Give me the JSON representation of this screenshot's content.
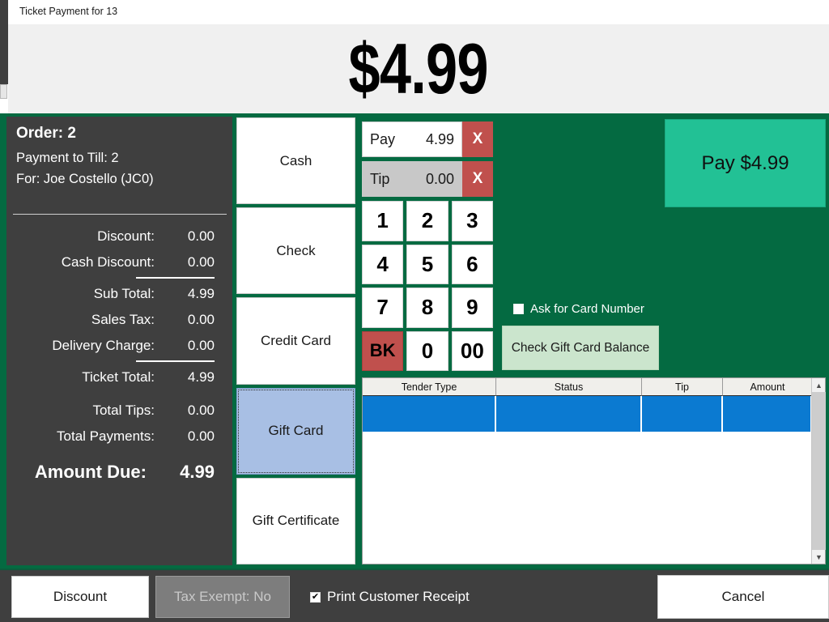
{
  "window": {
    "title": "Ticket Payment for 13"
  },
  "header": {
    "amount_display": "$4.99"
  },
  "colors": {
    "green_panel": "#046A41",
    "dark_sidebar": "#3f3f3f",
    "pay_button_teal": "#22c195",
    "delete_red": "#c0504d",
    "selected_tender_blue": "#a8bfe4",
    "grid_row_blue": "#0b7ad1",
    "gift_balance_green": "#cbe5cd"
  },
  "sidebar": {
    "order_label": "Order: 2",
    "payment_to_till": "Payment to Till: 2",
    "for_customer": "For: Joe Costello (JC0)",
    "rows": [
      {
        "label": "Discount:",
        "value": "0.00"
      },
      {
        "label": "Cash Discount:",
        "value": "0.00"
      },
      {
        "label": "Sub Total:",
        "value": "4.99"
      },
      {
        "label": "Sales Tax:",
        "value": "0.00"
      },
      {
        "label": "Delivery Charge:",
        "value": "0.00"
      },
      {
        "label": "Ticket Total:",
        "value": "4.99"
      },
      {
        "label": "Total Tips:",
        "value": "0.00"
      },
      {
        "label": "Total Payments:",
        "value": "0.00"
      }
    ],
    "amount_due_label": "Amount Due:",
    "amount_due_value": "4.99"
  },
  "tenders": {
    "items": [
      {
        "label": "Cash",
        "selected": false
      },
      {
        "label": "Check",
        "selected": false
      },
      {
        "label": "Credit Card",
        "selected": false
      },
      {
        "label": "Gift Card",
        "selected": true
      },
      {
        "label": "Gift Certificate",
        "selected": false
      }
    ]
  },
  "entry": {
    "pay_label": "Pay",
    "pay_value": "4.99",
    "pay_clear": "X",
    "tip_label": "Tip",
    "tip_value": "0.00",
    "tip_clear": "X",
    "keys": [
      "1",
      "2",
      "3",
      "4",
      "5",
      "6",
      "7",
      "8",
      "9",
      "BK",
      "0",
      "00"
    ]
  },
  "actions": {
    "pay_button": "Pay $4.99",
    "ask_card_number_label": "Ask for Card Number",
    "ask_card_number_checked": false,
    "check_gift_balance": "Check Gift Card Balance"
  },
  "table": {
    "columns": [
      "Tender Type",
      "Status",
      "Tip",
      "Amount"
    ],
    "rows": [
      {
        "tender_type": "",
        "status": "",
        "tip": "",
        "amount": ""
      }
    ],
    "scroll_up_icon": "▲",
    "scroll_down_icon": "▼"
  },
  "footer": {
    "discount_button": "Discount",
    "tax_exempt_button": "Tax Exempt: No",
    "print_receipt_label": "Print Customer Receipt",
    "print_receipt_checked": true,
    "print_receipt_mark": "✔",
    "cancel_button": "Cancel"
  }
}
